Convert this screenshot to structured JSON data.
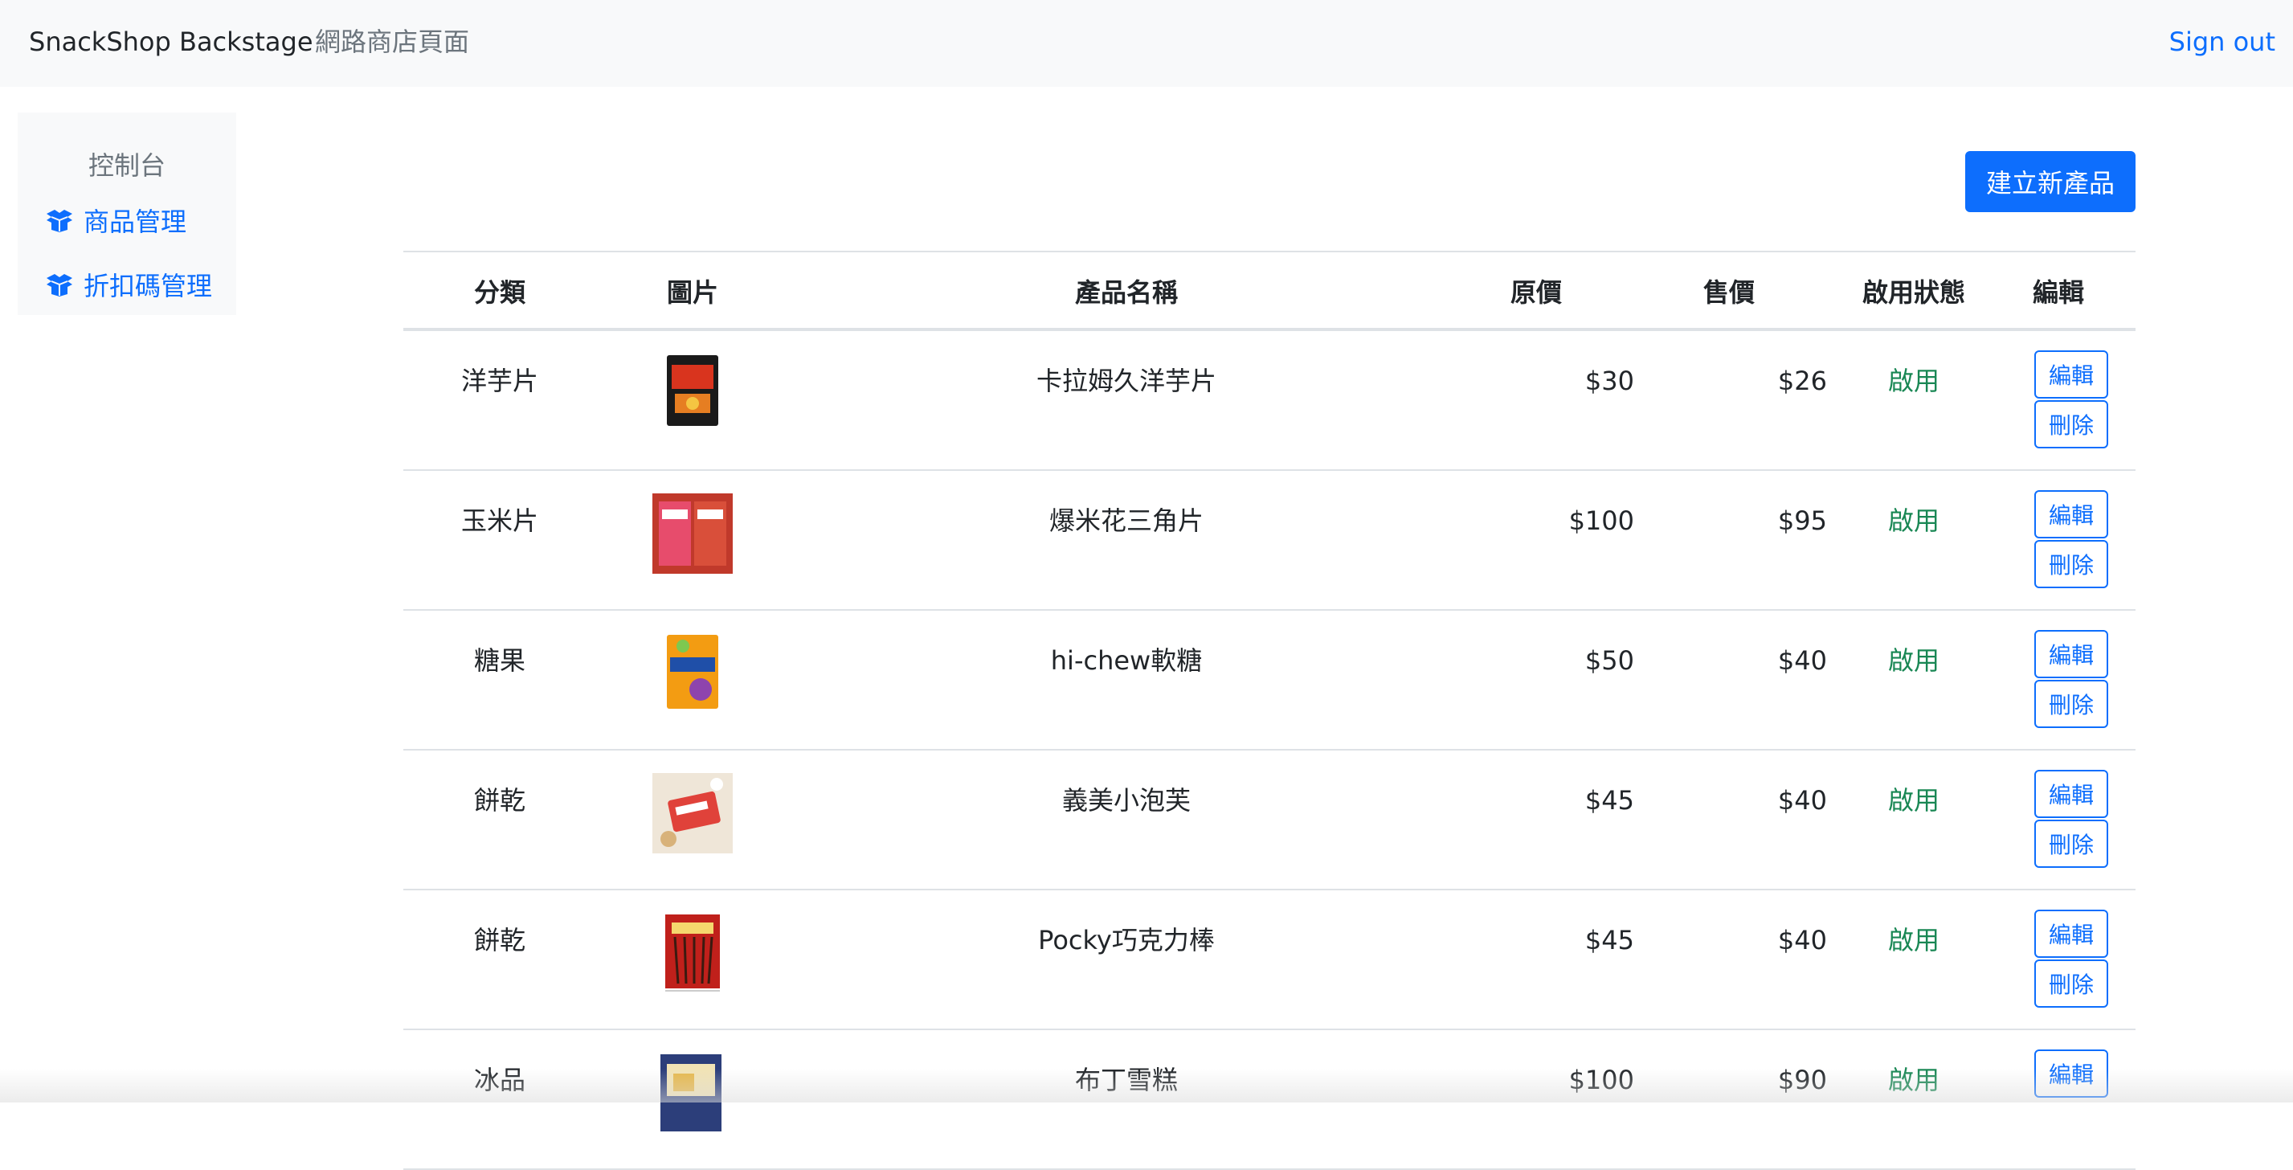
{
  "navbar": {
    "brand": "SnackShop Backstage",
    "store_link": "網路商店頁面",
    "signout": "Sign out"
  },
  "sidebar": {
    "heading": "控制台",
    "items": [
      {
        "label": "商品管理",
        "icon": "box-open-icon"
      },
      {
        "label": "折扣碼管理",
        "icon": "box-open-icon"
      }
    ]
  },
  "toolbar": {
    "create_label": "建立新產品"
  },
  "table": {
    "headers": [
      "分類",
      "圖片",
      "產品名稱",
      "原價",
      "售價",
      "啟用狀態",
      "編輯"
    ],
    "edit_label": "編輯",
    "delete_label": "刪除",
    "rows": [
      {
        "category": "洋芋片",
        "name": "卡拉姆久洋芋片",
        "origin_price": "$30",
        "price": "$26",
        "status": "啟用",
        "image": "chips-bag"
      },
      {
        "category": "玉米片",
        "name": "爆米花三角片",
        "origin_price": "$100",
        "price": "$95",
        "status": "啟用",
        "image": "corn-chips"
      },
      {
        "category": "糖果",
        "name": "hi-chew軟糖",
        "origin_price": "$50",
        "price": "$40",
        "status": "啟用",
        "image": "candy-bag"
      },
      {
        "category": "餅乾",
        "name": "義美小泡芙",
        "origin_price": "$45",
        "price": "$40",
        "status": "啟用",
        "image": "puff-box"
      },
      {
        "category": "餅乾",
        "name": "Pocky巧克力棒",
        "origin_price": "$45",
        "price": "$40",
        "status": "啟用",
        "image": "pocky-box"
      },
      {
        "category": "冰品",
        "name": "布丁雪糕",
        "origin_price": "$100",
        "price": "$90",
        "status": "啟用",
        "image": "icecream-box"
      }
    ]
  },
  "colors": {
    "primary": "#0d6efd",
    "success": "#198754",
    "muted": "#6c757d",
    "navbar_bg": "#f8f9fa"
  }
}
